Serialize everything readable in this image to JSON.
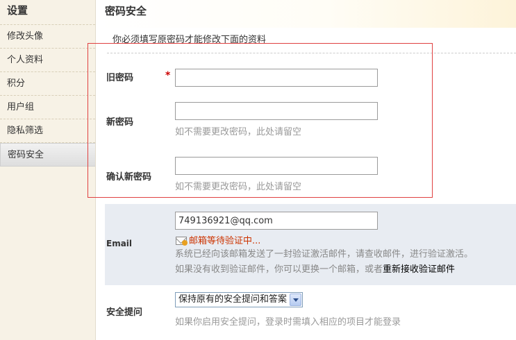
{
  "sidebar": {
    "title": "设置",
    "items": [
      {
        "label": "修改头像"
      },
      {
        "label": "个人资料"
      },
      {
        "label": "积分"
      },
      {
        "label": "用户组"
      },
      {
        "label": "隐私筛选"
      },
      {
        "label": "密码安全",
        "active": true
      }
    ]
  },
  "main": {
    "title": "密码安全",
    "notice": "你必须填写原密码才能修改下面的资料"
  },
  "form": {
    "old_password": {
      "label": "旧密码",
      "required_mark": "*",
      "value": ""
    },
    "new_password": {
      "label": "新密码",
      "value": "",
      "hint": "如不需要更改密码，此处请留空"
    },
    "confirm_password": {
      "label": "确认新密码",
      "value": "",
      "hint": "如不需要更改密码，此处请留空"
    },
    "email": {
      "label": "Email",
      "value": "749136921@qq.com",
      "pending_text": "邮箱等待验证中...",
      "desc_line1": "系统已经向该邮箱发送了一封验证激活邮件，请查收邮件，进行验证激活。",
      "desc_line2_prefix": "如果没有收到验证邮件，你可以更换一个邮箱，或者",
      "resend_link": "重新接收验证邮件"
    },
    "security_question": {
      "label": "安全提问",
      "selected": "保持原有的安全提问和答案",
      "hint": "如果你启用安全提问，登录时需填入相应的项目才能登录"
    }
  },
  "colors": {
    "highlight_border": "#e04040",
    "required": "#cc0000",
    "pending": "#cc3300",
    "email_bg": "#e8ecf2"
  },
  "icons": {
    "mail": "mail-pending-icon",
    "select_arrow": "chevron-down-icon"
  }
}
